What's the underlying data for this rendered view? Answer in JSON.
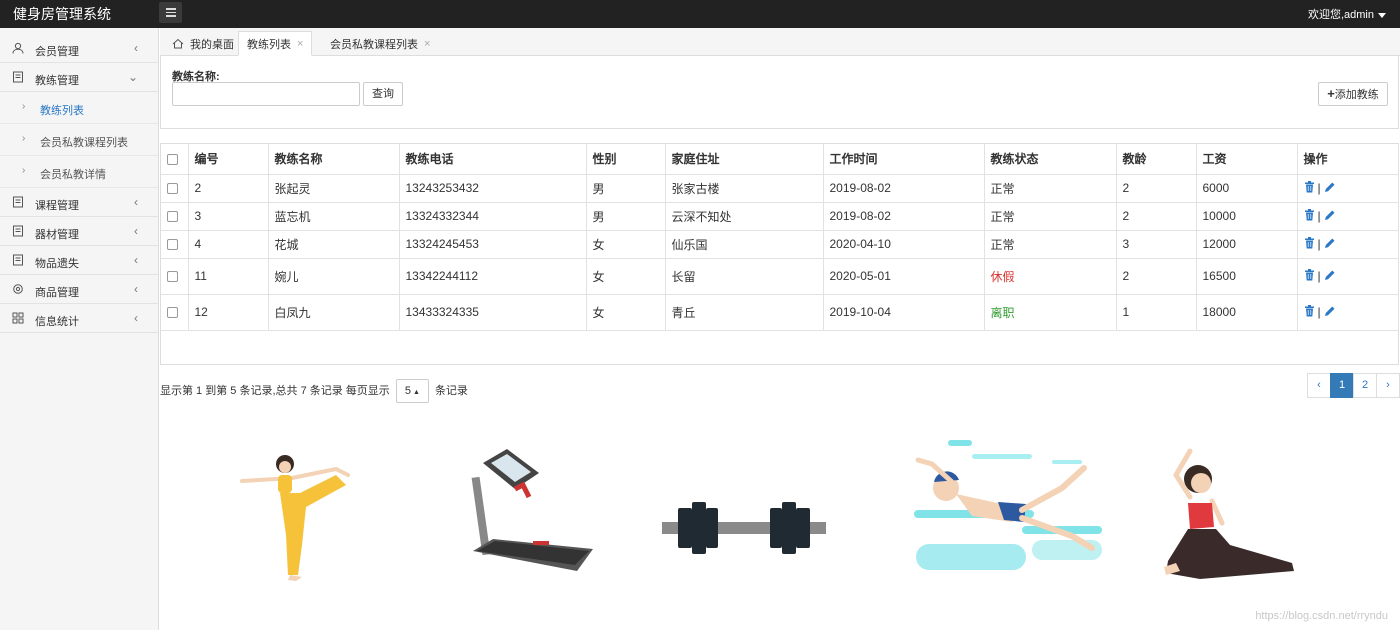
{
  "app": {
    "title": "健身房管理系统",
    "user": "欢迎您,admin"
  },
  "sidebar": {
    "items": [
      {
        "label": "会员管理",
        "arrow": "‹"
      },
      {
        "label": "教练管理",
        "arrow": "⌄"
      },
      {
        "label": "课程管理",
        "arrow": "‹"
      },
      {
        "label": "器材管理",
        "arrow": "‹"
      },
      {
        "label": "物品遗失",
        "arrow": "‹"
      },
      {
        "label": "商品管理",
        "arrow": "‹"
      },
      {
        "label": "信息统计",
        "arrow": "‹"
      }
    ],
    "subitems": [
      {
        "label": "教练列表"
      },
      {
        "label": "会员私教课程列表"
      },
      {
        "label": "会员私教详情"
      }
    ]
  },
  "tabs": [
    {
      "label": "我的桌面"
    },
    {
      "label": "教练列表",
      "close": "×"
    },
    {
      "label": "会员私教课程列表",
      "close": "×"
    }
  ],
  "search": {
    "label": "教练名称:",
    "value": "",
    "button": "查询",
    "add_button": "添加教练"
  },
  "table": {
    "headers": [
      "编号",
      "教练名称",
      "教练电话",
      "性别",
      "家庭住址",
      "工作时间",
      "教练状态",
      "教龄",
      "工资",
      "操作"
    ],
    "rows": [
      {
        "id": "2",
        "name": "张起灵",
        "phone": "13243253432",
        "gender": "男",
        "address": "张家古楼",
        "date": "2019-08-02",
        "status": "正常",
        "years": "2",
        "salary": "6000"
      },
      {
        "id": "3",
        "name": "蓝忘机",
        "phone": "13324332344",
        "gender": "男",
        "address": "云深不知处",
        "date": "2019-08-02",
        "status": "正常",
        "years": "2",
        "salary": "10000"
      },
      {
        "id": "4",
        "name": "花城",
        "phone": "13324245453",
        "gender": "女",
        "address": "仙乐国",
        "date": "2020-04-10",
        "status": "正常",
        "years": "3",
        "salary": "12000"
      },
      {
        "id": "11",
        "name": "婉儿",
        "phone": "13342244112",
        "gender": "女",
        "address": "长留",
        "date": "2020-05-01",
        "status": "休假",
        "years": "2",
        "salary": "16500"
      },
      {
        "id": "12",
        "name": "白凤九",
        "phone": "13433324335",
        "gender": "女",
        "address": "青丘",
        "date": "2019-10-04",
        "status": "离职",
        "years": "1",
        "salary": "18000"
      }
    ],
    "op_separator": "|"
  },
  "pagination": {
    "info_prefix": "显示第 1 到第 5 条记录,总共 7 条记录 每页显示",
    "page_size": "5",
    "info_suffix": "条记录",
    "prev": "‹",
    "pages": [
      "1",
      "2"
    ],
    "next": "›"
  },
  "watermark": "https://blog.csdn.net/rryndu",
  "colors": {
    "accent": "#337ab7",
    "leave": "#d9302c",
    "quit": "#2e9b2e",
    "topbar": "#222222"
  }
}
